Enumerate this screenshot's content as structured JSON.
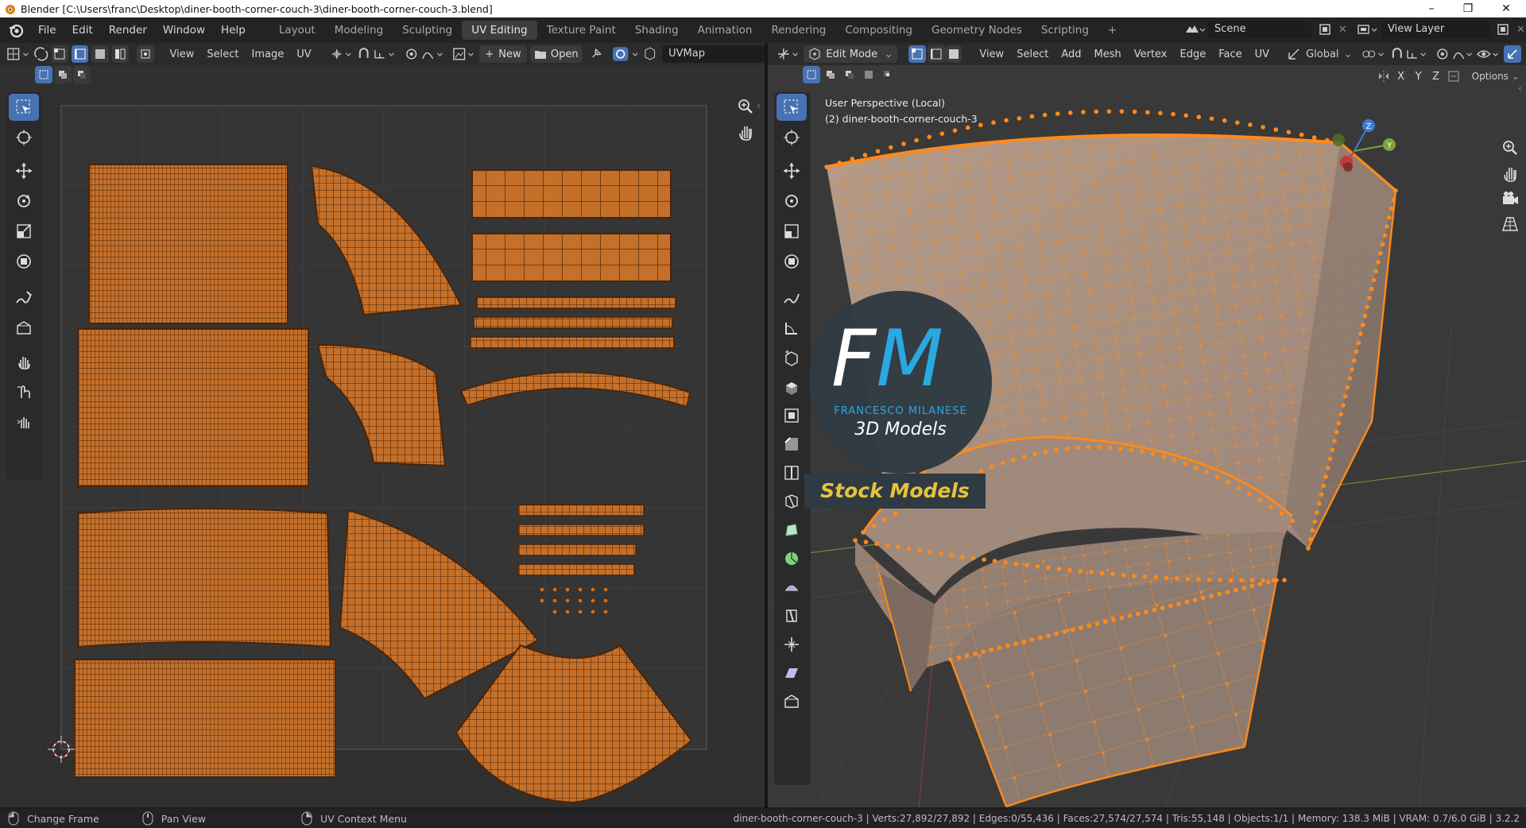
{
  "window": {
    "title": "Blender [C:\\Users\\franc\\Desktop\\diner-booth-corner-couch-3\\diner-booth-corner-couch-3.blend]",
    "minimize": "–",
    "maximize": "❐",
    "close": "✕"
  },
  "menus": [
    "File",
    "Edit",
    "Render",
    "Window",
    "Help"
  ],
  "workspaces": [
    "Layout",
    "Modeling",
    "Sculpting",
    "UV Editing",
    "Texture Paint",
    "Shading",
    "Animation",
    "Rendering",
    "Compositing",
    "Geometry Nodes",
    "Scripting"
  ],
  "active_workspace": "UV Editing",
  "add_workspace": "+",
  "scene": "Scene",
  "view_layer": "View Layer",
  "uv_editor": {
    "menus": [
      "View",
      "Select",
      "Image",
      "UV"
    ],
    "new_label": "New",
    "open_label": "Open",
    "uvmap": "UVMap"
  },
  "viewport": {
    "mode": "Edit Mode",
    "menus": [
      "View",
      "Select",
      "Add",
      "Mesh",
      "Vertex",
      "Edge",
      "Face",
      "UV"
    ],
    "orientation": "Global",
    "options": "Options",
    "axes": [
      "X",
      "Y",
      "Z"
    ],
    "info_line1": "User Perspective (Local)",
    "info_line2": "(2) diner-booth-corner-couch-3",
    "gizmo_labels": {
      "x": "X",
      "y": "Y",
      "z": "Z"
    }
  },
  "watermark": {
    "initials_f": "F",
    "initials_m": "M",
    "name": "FRANCESCO MILANESE",
    "subtitle": "3D Models",
    "banner": "Stock Models"
  },
  "status": {
    "left": [
      {
        "icon": "mouse-left-icon",
        "label": "Change Frame"
      },
      {
        "icon": "mouse-middle-icon",
        "label": "Pan View"
      },
      {
        "icon": "mouse-right-icon",
        "label": "UV Context Menu"
      }
    ],
    "stats": "diner-booth-corner-couch-3 | Verts:27,892/27,892 | Edges:0/55,436 | Faces:27,574/27,574 | Tris:55,148 | Objects:1/1 | Memory: 138.3 MiB | VRAM: 0.7/6.0 GiB | 3.2.2"
  },
  "colors": {
    "accent": "#4772b3",
    "uv_island": "#c46f2a",
    "selection": "#ff8a1a",
    "logo_blue": "#2aa8e0"
  }
}
